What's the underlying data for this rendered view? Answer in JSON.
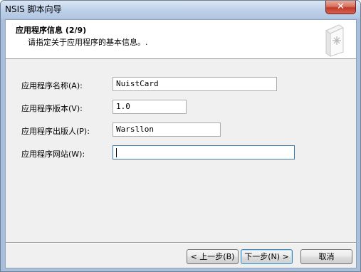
{
  "window": {
    "title": "NSIS 脚本向导",
    "close_glyph": "✕"
  },
  "header": {
    "title": "应用程序信息 (2/9)",
    "subtitle": "请指定关于应用程序的基本信息。."
  },
  "form": {
    "fields": [
      {
        "label": "应用程序名称(A):",
        "value": "NuistCard"
      },
      {
        "label": "应用程序版本(V):",
        "value": "1.0"
      },
      {
        "label": "应用程序出版人(P):",
        "value": "Warsllon"
      },
      {
        "label": "应用程序网站(W):",
        "value": ""
      }
    ]
  },
  "buttons": {
    "back": "< 上一步(B)",
    "next": "下一步(N) >",
    "cancel": "取消"
  }
}
